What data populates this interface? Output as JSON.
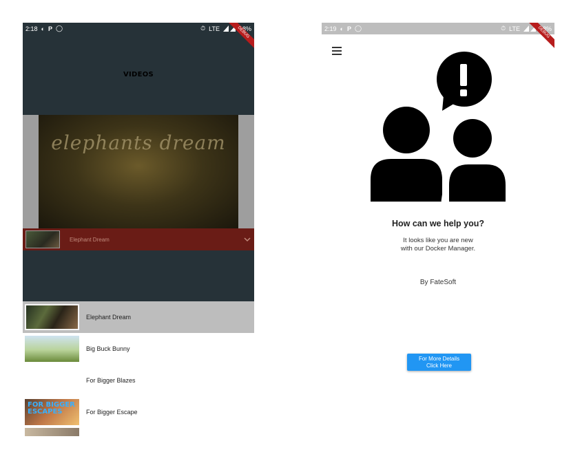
{
  "left_screen": {
    "status_bar": {
      "time": "2:18",
      "battery": "88%",
      "network": "LTE"
    },
    "debug_banner": "DEBUG",
    "app_bar": {
      "title": "VIDEOS"
    },
    "player": {
      "title_art": "elephants dream"
    },
    "dropdown": {
      "selected": "Elephant Dream"
    },
    "videos": [
      {
        "title": "Elephant Dream",
        "selected": true,
        "thumb": "elephant-dream-thumbnail"
      },
      {
        "title": "Big Buck Bunny",
        "selected": false,
        "thumb": "big-buck-bunny-thumbnail"
      },
      {
        "title": "For Bigger Blazes",
        "selected": false,
        "thumb": ""
      },
      {
        "title": "For Bigger Escape",
        "selected": false,
        "thumb": "for-bigger-escape-thumbnail",
        "thumb_text": "FOR BIGGER ESCAPES"
      }
    ]
  },
  "right_screen": {
    "status_bar": {
      "time": "2:19",
      "battery": "88%",
      "network": "LTE"
    },
    "debug_banner": "DEBUG",
    "heading": "How can we help you?",
    "text_line1": "It looks like you are new",
    "text_line2": "with our Docker Manager.",
    "by_line": "By FateSoft",
    "button_line1": "For More Details",
    "button_line2": "Click Here"
  },
  "colors": {
    "dark_bg": "#263238",
    "dropdown_bg": "#6a1c16",
    "button": "#2196f3",
    "selected_row": "#bdbdbd"
  }
}
